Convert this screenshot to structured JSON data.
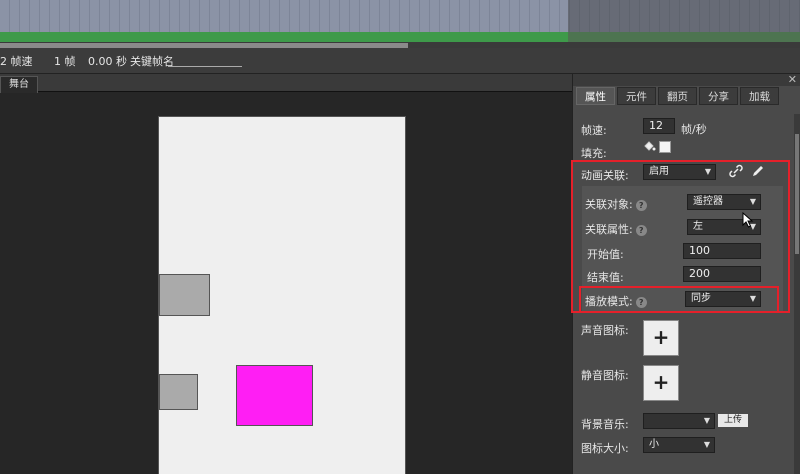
{
  "statusbar": {
    "fps": "2 帧速",
    "frame": "1 帧",
    "time": "0.00 秒",
    "keyframe_label": "关键帧名"
  },
  "stage": {
    "tab": "舞台"
  },
  "panel": {
    "tabs": [
      "属性",
      "元件",
      "翻页",
      "分享",
      "加载"
    ],
    "fps_label": "帧速:",
    "fps_value": "12",
    "fps_unit": "帧/秒",
    "fill_label": "填充:",
    "anim_label": "动画关联:",
    "anim_value": "启用",
    "target_label": "关联对象:",
    "target_value": "遥控器",
    "prop_label": "关联属性:",
    "prop_value": "左",
    "start_label": "开始值:",
    "start_value": "100",
    "end_label": "结束值:",
    "end_value": "200",
    "mode_label": "播放模式:",
    "mode_value": "同步",
    "sound_icon_label": "声音图标:",
    "mute_icon_label": "静音图标:",
    "bgm_label": "背景音乐:",
    "bgm_value": "",
    "upload_label": "上传",
    "icon_size_label": "图标大小:",
    "icon_size_value": "小",
    "plus": "+"
  },
  "colors": {
    "highlight": "#e5202a",
    "magenta": "#ff1ef4",
    "timeline_green": "#3e9a4a"
  }
}
